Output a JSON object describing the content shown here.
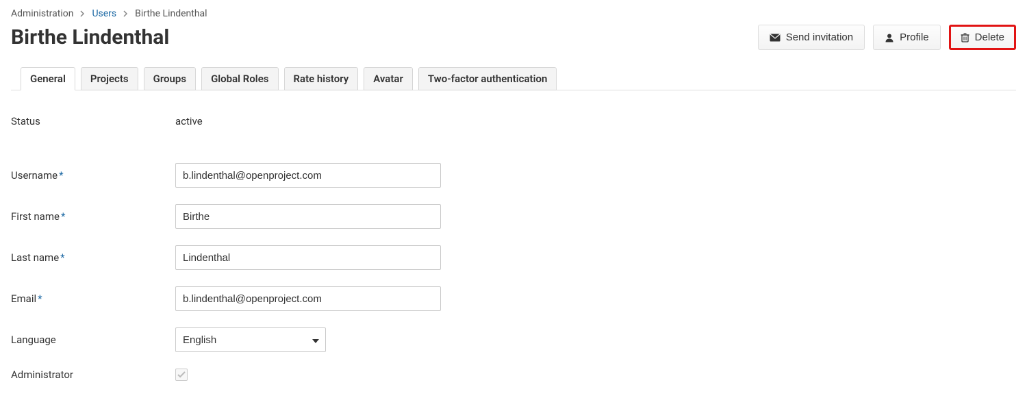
{
  "breadcrumb": {
    "administration": "Administration",
    "users": "Users",
    "current": "Birthe Lindenthal"
  },
  "page_title": "Birthe Lindenthal",
  "actions": {
    "send_invitation": "Send invitation",
    "profile": "Profile",
    "delete": "Delete"
  },
  "tabs": {
    "general": "General",
    "projects": "Projects",
    "groups": "Groups",
    "global_roles": "Global Roles",
    "rate_history": "Rate history",
    "avatar": "Avatar",
    "two_factor": "Two-factor authentication"
  },
  "form": {
    "status_label": "Status",
    "status_value": "active",
    "username_label": "Username",
    "username_value": "b.lindenthal@openproject.com",
    "firstname_label": "First name",
    "firstname_value": "Birthe",
    "lastname_label": "Last name",
    "lastname_value": "Lindenthal",
    "email_label": "Email",
    "email_value": "b.lindenthal@openproject.com",
    "language_label": "Language",
    "language_value": "English",
    "administrator_label": "Administrator",
    "administrator_checked": true
  }
}
